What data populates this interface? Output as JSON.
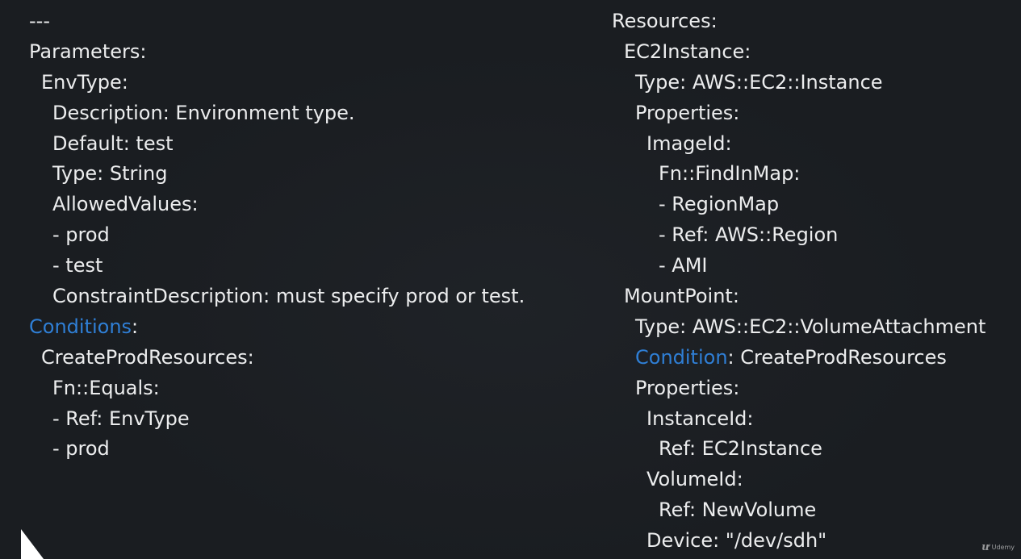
{
  "colors": {
    "background": "#1a1d21",
    "text": "#ecedee",
    "keyword": "#2f7fd6"
  },
  "left_column": {
    "doc_start": "---",
    "parameters_key": "Parameters:",
    "envtype_key": "EnvType:",
    "description_line": "Description: Environment type.",
    "default_line": "Default: test",
    "type_line": "Type: String",
    "allowed_values_key": "AllowedValues:",
    "allowed_prod": "- prod",
    "allowed_test": "- test",
    "constraint_line": "ConstraintDescription: must specify prod or test.",
    "conditions_keyword": "Conditions",
    "colon": ":",
    "create_prod_key": "CreateProdResources:",
    "fn_equals_key": "Fn::Equals:",
    "ref_envtype": "- Ref: EnvType",
    "equals_prod": "- prod"
  },
  "right_column": {
    "resources_key": "Resources:",
    "ec2instance_key": "EC2Instance:",
    "ec2_type_line": "Type: AWS::EC2::Instance",
    "ec2_properties_key": "Properties:",
    "imageid_key": "ImageId:",
    "findinmap_key": "Fn::FindInMap:",
    "regionmap_item": "- RegionMap",
    "ref_region_item": "- Ref: AWS::Region",
    "ami_item": "- AMI",
    "mountpoint_key": "MountPoint:",
    "mount_type_line": "Type: AWS::EC2::VolumeAttachment",
    "condition_keyword": "Condition",
    "condition_value": ": CreateProdResources",
    "mount_properties_key": "Properties:",
    "instanceid_key": "InstanceId:",
    "ref_ec2instance": "Ref: EC2Instance",
    "volumeid_key": "VolumeId:",
    "ref_newvolume": "Ref: NewVolume",
    "device_line": "Device: \"/dev/sdh\""
  },
  "watermark": {
    "text": "Udemy"
  }
}
